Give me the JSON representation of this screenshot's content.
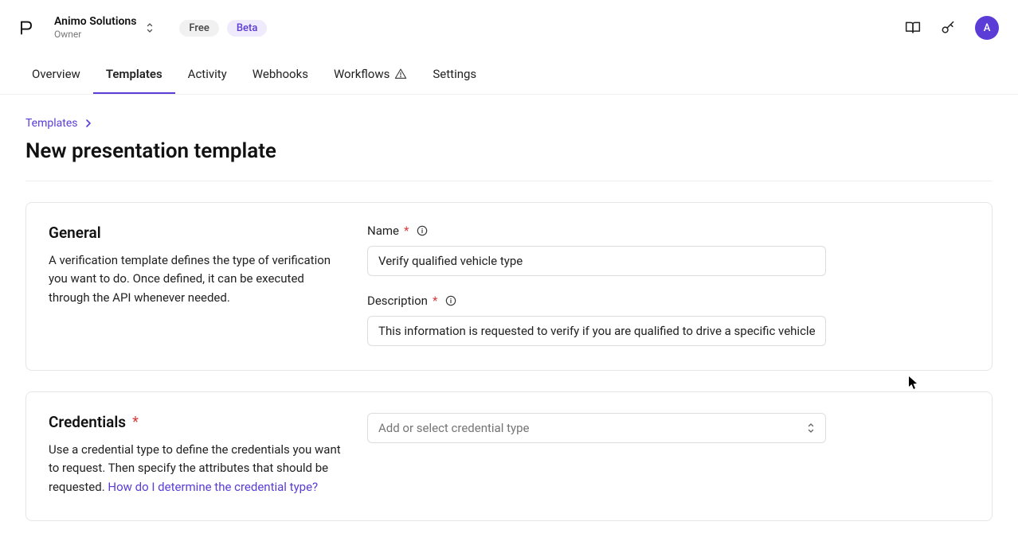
{
  "header": {
    "org_name": "Animo Solutions",
    "org_role": "Owner",
    "badge_free": "Free",
    "badge_beta": "Beta",
    "avatar_letter": "A"
  },
  "nav": {
    "items": [
      {
        "label": "Overview"
      },
      {
        "label": "Templates"
      },
      {
        "label": "Activity"
      },
      {
        "label": "Webhooks"
      },
      {
        "label": "Workflows"
      },
      {
        "label": "Settings"
      }
    ],
    "active_index": 1,
    "workflows_has_warning": true
  },
  "breadcrumb": {
    "link": "Templates"
  },
  "page_title": "New presentation template",
  "general": {
    "heading": "General",
    "description": "A verification template defines the type of verification you want to do. Once defined, it can be executed through the API whenever needed.",
    "name_label": "Name",
    "name_value": "Verify qualified vehicle type",
    "desc_label": "Description",
    "desc_value": "This information is requested to verify if you are qualified to drive a specific vehicle"
  },
  "credentials": {
    "heading": "Credentials",
    "description_prefix": "Use a credential type to define the credentials you want to request. Then specify the attributes that should be requested. ",
    "help_link": "How do I determine the credential type?",
    "select_placeholder": "Add or select credential type"
  }
}
